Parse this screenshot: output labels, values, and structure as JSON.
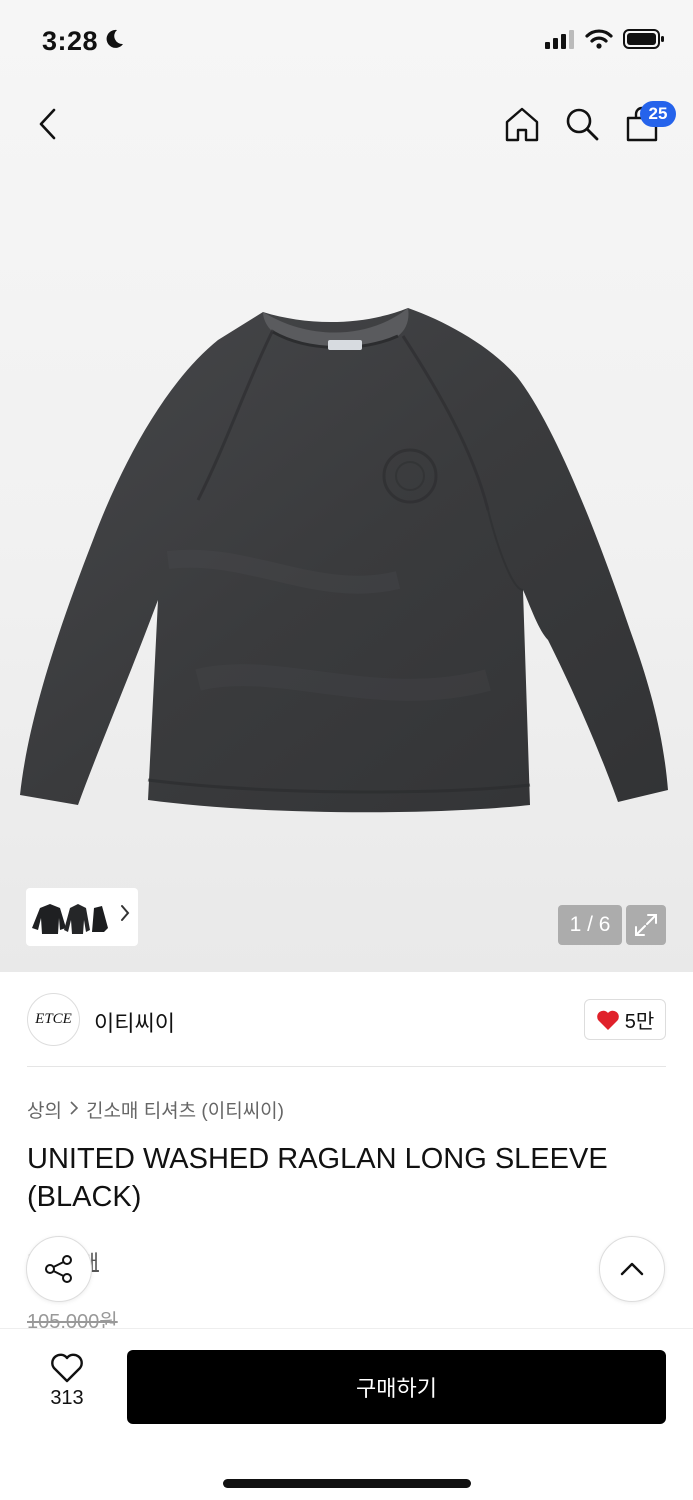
{
  "status_bar": {
    "time": "3:28"
  },
  "nav": {
    "cart_count": "25"
  },
  "gallery": {
    "counter": "1 / 6"
  },
  "brand": {
    "logo_text": "ETCE",
    "name": "이티씨이",
    "likes": "5만"
  },
  "breadcrumb": {
    "level1": "상의",
    "level2": "긴소매 티셔츠 (이티씨이)"
  },
  "product": {
    "title": "UNITED WASHED RAGLAN LONG SLEEVE (BLACK)",
    "review_link": "후기 7개",
    "original_price": "105,000원"
  },
  "bottom_bar": {
    "wish_count": "313",
    "buy_label": "구매하기"
  },
  "colors": {
    "badge": "#2563eb",
    "heart": "#e0212a",
    "buy_button": "#000000",
    "shirt": "#3b3c3e"
  }
}
